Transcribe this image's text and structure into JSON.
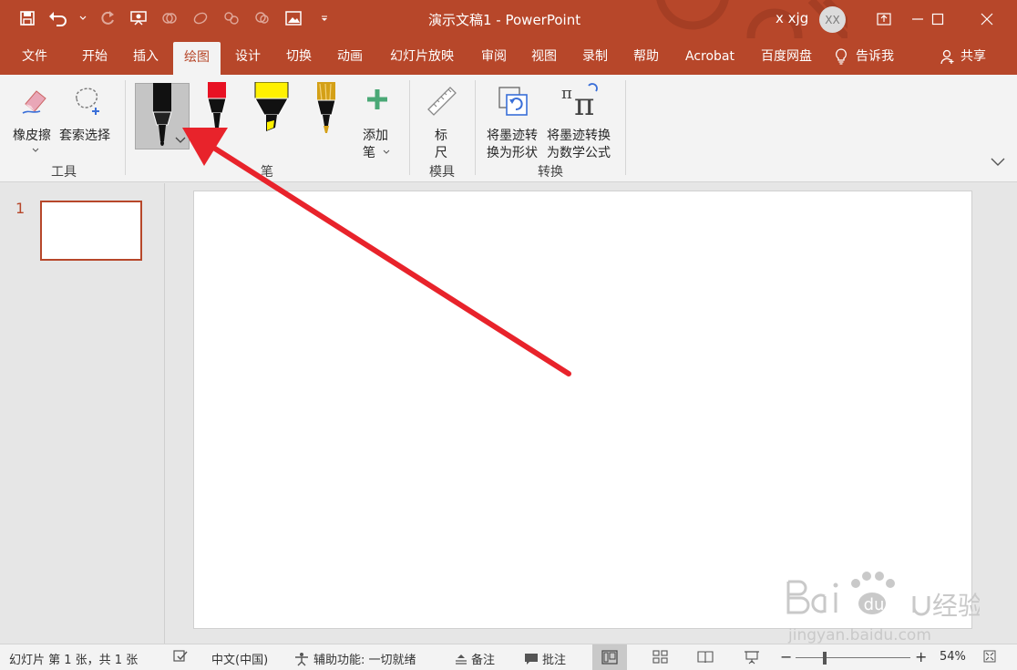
{
  "window": {
    "doc_title": "演示文稿1  -  PowerPoint",
    "user_name": "x xjg",
    "avatar_initials": "XX",
    "accent": "#b7472a"
  },
  "tabs": [
    {
      "label": "文件"
    },
    {
      "label": "开始"
    },
    {
      "label": "插入"
    },
    {
      "label": "绘图",
      "active": true
    },
    {
      "label": "设计"
    },
    {
      "label": "切换"
    },
    {
      "label": "动画"
    },
    {
      "label": "幻灯片放映"
    },
    {
      "label": "审阅"
    },
    {
      "label": "视图"
    },
    {
      "label": "录制"
    },
    {
      "label": "帮助"
    },
    {
      "label": "Acrobat"
    },
    {
      "label": "百度网盘"
    },
    {
      "label": "告诉我"
    },
    {
      "label": "共享"
    }
  ],
  "ribbon": {
    "tools": {
      "eraser_label": "橡皮擦",
      "lasso_label": "套索选择",
      "group_label": "工具"
    },
    "pens": {
      "add_pen_line1": "添加",
      "add_pen_line2": "笔",
      "group_label": "笔",
      "colors": {
        "black": "#111111",
        "red": "#e81123",
        "yellow": "#fff100",
        "gold": "#d4a017"
      }
    },
    "stencils": {
      "ruler_line1": "标",
      "ruler_line2": "尺",
      "group_label": "模具"
    },
    "convert": {
      "ink_to_shape_line1": "将墨迹转",
      "ink_to_shape_line2": "换为形状",
      "ink_to_math_line1": "将墨迹转换",
      "ink_to_math_line2": "为数学公式",
      "group_label": "转换"
    }
  },
  "thumbnails": {
    "slide_number": "1"
  },
  "status": {
    "slide_info": "幻灯片 第 1 张，共 1 张",
    "language": "中文(中国)",
    "accessibility": "辅助功能: 一切就绪",
    "notes": "备注",
    "comments": "批注",
    "zoom_minus": "−",
    "zoom_plus": "+",
    "zoom_level": "54%"
  }
}
